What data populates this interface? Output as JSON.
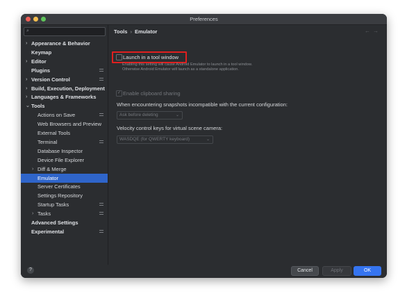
{
  "window": {
    "title": "Preferences"
  },
  "search": {
    "icon": "search-icon"
  },
  "sidebar": {
    "items": [
      {
        "label": "Appearance & Behavior",
        "bold": true,
        "arrow": "›",
        "config": false
      },
      {
        "label": "Keymap",
        "bold": true,
        "arrow": "",
        "config": false
      },
      {
        "label": "Editor",
        "bold": true,
        "arrow": "›",
        "config": false
      },
      {
        "label": "Plugins",
        "bold": true,
        "arrow": "",
        "config": true
      },
      {
        "label": "Version Control",
        "bold": true,
        "arrow": "›",
        "config": true
      },
      {
        "label": "Build, Execution, Deployment",
        "bold": true,
        "arrow": "›",
        "config": false
      },
      {
        "label": "Languages & Frameworks",
        "bold": true,
        "arrow": "›",
        "config": false
      },
      {
        "label": "Tools",
        "bold": true,
        "arrow": "⌄",
        "config": false
      },
      {
        "label": "Actions on Save",
        "bold": false,
        "arrow": "",
        "config": true
      },
      {
        "label": "Web Browsers and Preview",
        "bold": false,
        "arrow": "",
        "config": false
      },
      {
        "label": "External Tools",
        "bold": false,
        "arrow": "",
        "config": false
      },
      {
        "label": "Terminal",
        "bold": false,
        "arrow": "",
        "config": true
      },
      {
        "label": "Database Inspector",
        "bold": false,
        "arrow": "",
        "config": false
      },
      {
        "label": "Device File Explorer",
        "bold": false,
        "arrow": "",
        "config": false
      },
      {
        "label": "Diff & Merge",
        "bold": false,
        "arrow": "›",
        "config": false
      },
      {
        "label": "Emulator",
        "bold": false,
        "arrow": "",
        "config": false,
        "selected": true
      },
      {
        "label": "Server Certificates",
        "bold": false,
        "arrow": "",
        "config": false
      },
      {
        "label": "Settings Repository",
        "bold": false,
        "arrow": "",
        "config": false
      },
      {
        "label": "Startup Tasks",
        "bold": false,
        "arrow": "",
        "config": true
      },
      {
        "label": "Tasks",
        "bold": false,
        "arrow": "›",
        "config": true
      },
      {
        "label": "Advanced Settings",
        "bold": true,
        "arrow": "",
        "config": false
      },
      {
        "label": "Experimental",
        "bold": true,
        "arrow": "",
        "config": true
      }
    ]
  },
  "breadcrumb": {
    "parent": "Tools",
    "separator": "›",
    "current": "Emulator"
  },
  "nav": {
    "back": "←",
    "forward": "→"
  },
  "settings": {
    "launch_label": "Launch in a tool window",
    "launch_checked": false,
    "launch_desc": "Enabling this setting will cause Android Emulator to launch in a tool window. Otherwise Android Emulator will launch as a standalone application.",
    "clipboard_label": "Enable clipboard sharing",
    "clipboard_checked": true,
    "snapshots_label": "When encountering snapshots incompatible with the current configuration:",
    "snapshots_value": "Ask before deleting",
    "velocity_label": "Velocity control keys for virtual scene camera:",
    "velocity_value": "WASDQE (for QWERTY keyboard)"
  },
  "buttons": {
    "help": "?",
    "cancel": "Cancel",
    "apply": "Apply",
    "ok": "OK"
  },
  "colors": {
    "accent": "#3574f0",
    "selection": "#2f65ca",
    "highlight": "#e01f1f",
    "background": "#2b2d30"
  }
}
